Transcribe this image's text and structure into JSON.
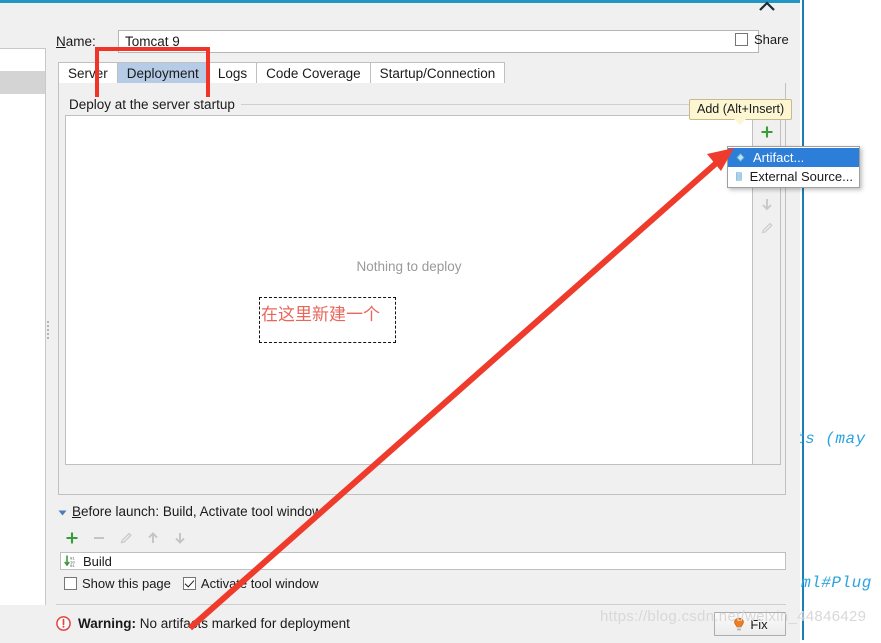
{
  "window": {
    "title_bar_color": "#2196c4",
    "close_icon": "close-icon"
  },
  "name_field": {
    "label": "Name:",
    "label_accel": "N",
    "value": "Tomcat 9",
    "placeholder": ""
  },
  "share": {
    "label": "Share",
    "checked": false
  },
  "tabs": [
    {
      "label": "Server",
      "active": false
    },
    {
      "label": "Deployment",
      "active": true
    },
    {
      "label": "Logs",
      "active": false
    },
    {
      "label": "Code Coverage",
      "active": false
    },
    {
      "label": "Startup/Connection",
      "active": false
    }
  ],
  "deployment": {
    "group_label": "Deploy at the server startup",
    "empty_text": "Nothing to deploy",
    "toolbar": [
      {
        "name": "add-button",
        "glyph": "plus",
        "enabled": true
      },
      {
        "name": "remove-button",
        "glyph": "minus",
        "enabled": false
      },
      {
        "name": "move-up-button",
        "glyph": "up",
        "enabled": false
      },
      {
        "name": "move-down-button",
        "glyph": "down",
        "enabled": false
      },
      {
        "name": "edit-button",
        "glyph": "pencil",
        "enabled": false
      }
    ]
  },
  "add_tooltip": {
    "text": "Add (Alt+Insert)"
  },
  "add_menu": {
    "items": [
      {
        "label": "Artifact...",
        "icon": "artifact-diamond-icon",
        "selected": true
      },
      {
        "label": "External Source...",
        "icon": "external-source-icon",
        "selected": false
      }
    ]
  },
  "before_launch": {
    "title": "Before launch: Build, Activate tool window",
    "title_accel": "B",
    "toolbar": [
      {
        "name": "add-task-button",
        "glyph": "plus",
        "enabled": true
      },
      {
        "name": "remove-task-button",
        "glyph": "minus",
        "enabled": false
      },
      {
        "name": "edit-task-button",
        "glyph": "pencil",
        "enabled": false
      },
      {
        "name": "move-task-up-button",
        "glyph": "up",
        "enabled": false
      },
      {
        "name": "move-task-down-button",
        "glyph": "down",
        "enabled": false
      }
    ],
    "task": {
      "label": "Build",
      "icon": "build-compile-icon"
    },
    "checkboxes": [
      {
        "label": "Show this page",
        "checked": false
      },
      {
        "label": "Activate tool window",
        "checked": true
      }
    ]
  },
  "warning": {
    "prefix": "Warning:",
    "message": "No artifacts marked for deployment",
    "icon": "warning-icon",
    "fix_button": {
      "label": "Fix",
      "icon": "lightbulb-icon"
    }
  },
  "annotations": {
    "red_rect_target": "Deployment tab",
    "chinese_note": "在这里新建一个",
    "arrow_color": "#ef3b2c",
    "red_color": "#f03528"
  },
  "background_editor": {
    "code_fragment_1": "ts (may ",
    "code_fragment_2": "tml#Plug"
  },
  "watermark": {
    "text": "https://blog.csdn.net/weixin_44846429"
  }
}
